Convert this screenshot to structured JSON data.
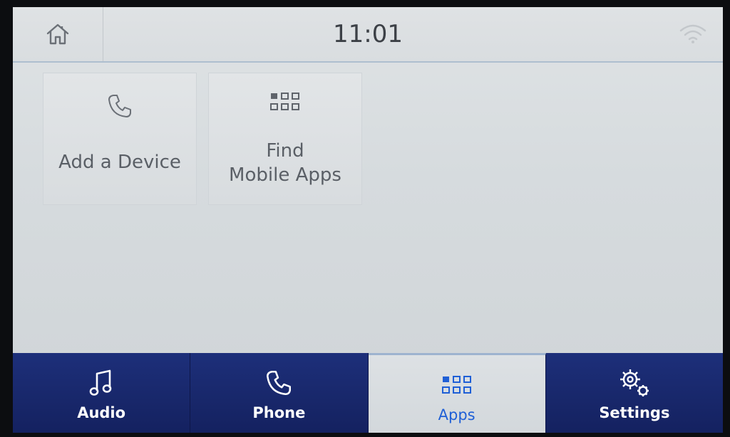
{
  "header": {
    "time": "11:01",
    "home_icon": "home-icon",
    "status_icon": "wifi-icon"
  },
  "tiles": [
    {
      "label": "Add a Device",
      "icon": "phone-icon"
    },
    {
      "label_line1": "Find",
      "label_line2": "Mobile Apps",
      "icon": "apps-grid-icon"
    }
  ],
  "nav": {
    "items": [
      {
        "label": "Audio",
        "icon": "music-note-icon",
        "active": false
      },
      {
        "label": "Phone",
        "icon": "phone-icon",
        "active": false
      },
      {
        "label": "Apps",
        "icon": "apps-grid-icon",
        "active": true
      },
      {
        "label": "Settings",
        "icon": "gear-icon",
        "active": false
      }
    ]
  },
  "colors": {
    "nav_bg": "#18276a",
    "active_accent": "#1f5fd6",
    "screen_bg": "#d6dbde",
    "text_dark": "#3c4046"
  }
}
